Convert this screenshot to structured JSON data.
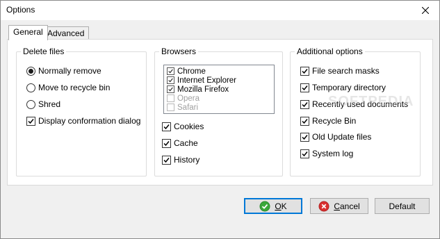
{
  "window": {
    "title": "Options"
  },
  "tabs": [
    {
      "label": "General",
      "active": true
    },
    {
      "label": "Advanced",
      "active": false
    }
  ],
  "delete_files": {
    "title": "Delete files",
    "radios": [
      {
        "label": "Normally remove",
        "checked": true
      },
      {
        "label": "Move to recycle bin",
        "checked": false
      },
      {
        "label": "Shred",
        "checked": false
      }
    ],
    "checkbox": {
      "label": "Display conformation dialog",
      "checked": true
    }
  },
  "browsers": {
    "title": "Browsers",
    "list": [
      {
        "label": "Chrome",
        "checked": true,
        "enabled": true
      },
      {
        "label": "Internet Explorer",
        "checked": true,
        "enabled": true
      },
      {
        "label": "Mozilla Firefox",
        "checked": true,
        "enabled": true
      },
      {
        "label": "Opera",
        "checked": false,
        "enabled": false
      },
      {
        "label": "Safari",
        "checked": false,
        "enabled": false
      }
    ],
    "options": [
      {
        "label": "Cookies",
        "checked": true
      },
      {
        "label": "Cache",
        "checked": true
      },
      {
        "label": "History",
        "checked": true
      }
    ]
  },
  "additional": {
    "title": "Additional options",
    "options": [
      {
        "label": "File search masks",
        "checked": true
      },
      {
        "label": "Temporary directory",
        "checked": true
      },
      {
        "label": "Recently used documents",
        "checked": true
      },
      {
        "label": "Recycle Bin",
        "checked": true
      },
      {
        "label": "Old Update files",
        "checked": true
      },
      {
        "label": "System log",
        "checked": true
      }
    ]
  },
  "buttons": {
    "ok": {
      "mnemonic": "O",
      "rest": "K"
    },
    "cancel": {
      "mnemonic": "C",
      "rest": "ancel"
    },
    "default": "Default"
  },
  "watermark": "SOFTPEDIA",
  "colors": {
    "ok_icon": "#3aa83a",
    "cancel_icon": "#d93030",
    "focus_border": "#0078d7"
  },
  "icons": {
    "ok": "check-circle-icon",
    "cancel": "cross-circle-icon",
    "close": "close-icon"
  }
}
